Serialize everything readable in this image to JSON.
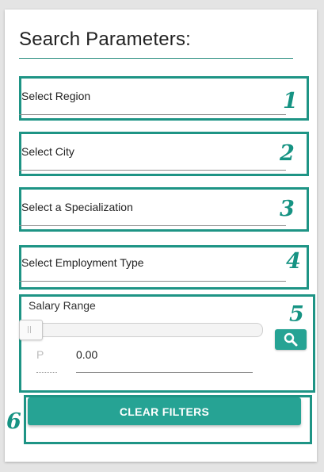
{
  "panel": {
    "title": "Search Parameters:"
  },
  "filters": [
    {
      "label": "Select Region",
      "marker": "1"
    },
    {
      "label": "Select City",
      "marker": "2"
    },
    {
      "label": "Select a Specialization",
      "marker": "3"
    },
    {
      "label": "Select Employment Type",
      "marker": "4"
    }
  ],
  "salary": {
    "title": "Salary Range",
    "marker": "5",
    "currency": "P",
    "amount": "0.00",
    "slider_level": 0,
    "search_icon": "search-icon"
  },
  "actions": {
    "clear_label": "CLEAR FILTERS",
    "marker": "6"
  },
  "colors": {
    "accent": "#26a394",
    "annotation": "#1e9485"
  }
}
